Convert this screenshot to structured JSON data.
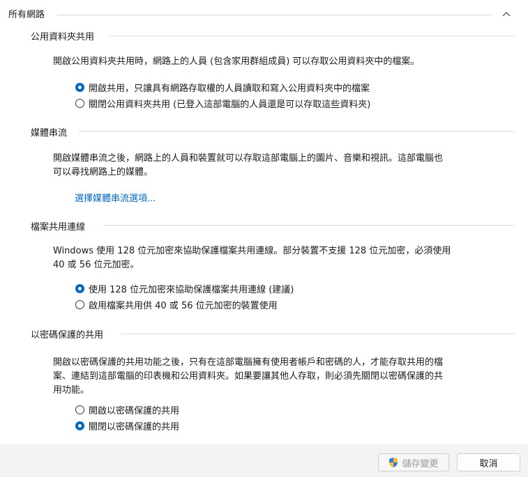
{
  "group": {
    "title": "所有網路",
    "collapse_icon": "chevron-up-icon"
  },
  "sections": {
    "public_folder": {
      "title": "公用資料夾共用",
      "description": "開啟公用資料夾共用時，網路上的人員 (包含家用群組成員) 可以存取公用資料夾中的檔案。",
      "options": [
        {
          "label": "開啟共用，只讓具有網路存取權的人員讀取和寫入公用資料夾中的檔案",
          "selected": true
        },
        {
          "label": "關閉公用資料夾共用 (已登入這部電腦的人員還是可以存取這些資料夾)",
          "selected": false
        }
      ]
    },
    "media": {
      "title": "媒體串流",
      "description_line1": "開啟媒體串流之後，網路上的人員和裝置就可以存取這部電腦上的圖片、音樂和視訊。這部電腦也",
      "description_line2": "可以尋找網路上的媒體。",
      "link": "選擇媒體串流選項..."
    },
    "file_sharing": {
      "title": "檔案共用連線",
      "description_line1": "Windows 使用 128 位元加密來協助保護檔案共用連線。部分裝置不支援 128 位元加密，必須使用",
      "description_line2": "40 或 56 位元加密。",
      "options": [
        {
          "label": "使用 128 位元加密來協助保護檔案共用連線 (建議)",
          "selected": true
        },
        {
          "label": "啟用檔案共用供 40 或 56 位元加密的裝置使用",
          "selected": false
        }
      ]
    },
    "password": {
      "title": "以密碼保護的共用",
      "description_line1": "開啟以密碼保護的共用功能之後，只有在這部電腦擁有使用者帳戶和密碼的人，才能存取共用的檔",
      "description_line2": "案、連結到這部電腦的印表機和公用資料夾。如果要讓其他人存取，則必須先關閉以密碼保護的共",
      "description_line3": "用功能。",
      "options": [
        {
          "label": "開啟以密碼保護的共用",
          "selected": false
        },
        {
          "label": "關閉以密碼保護的共用",
          "selected": true
        }
      ]
    }
  },
  "footer": {
    "save_label": "儲存變更",
    "save_icon": "shield-icon",
    "cancel_label": "取消"
  },
  "colors": {
    "accent": "#0067c0",
    "footer_bg": "#f3f3f3"
  }
}
